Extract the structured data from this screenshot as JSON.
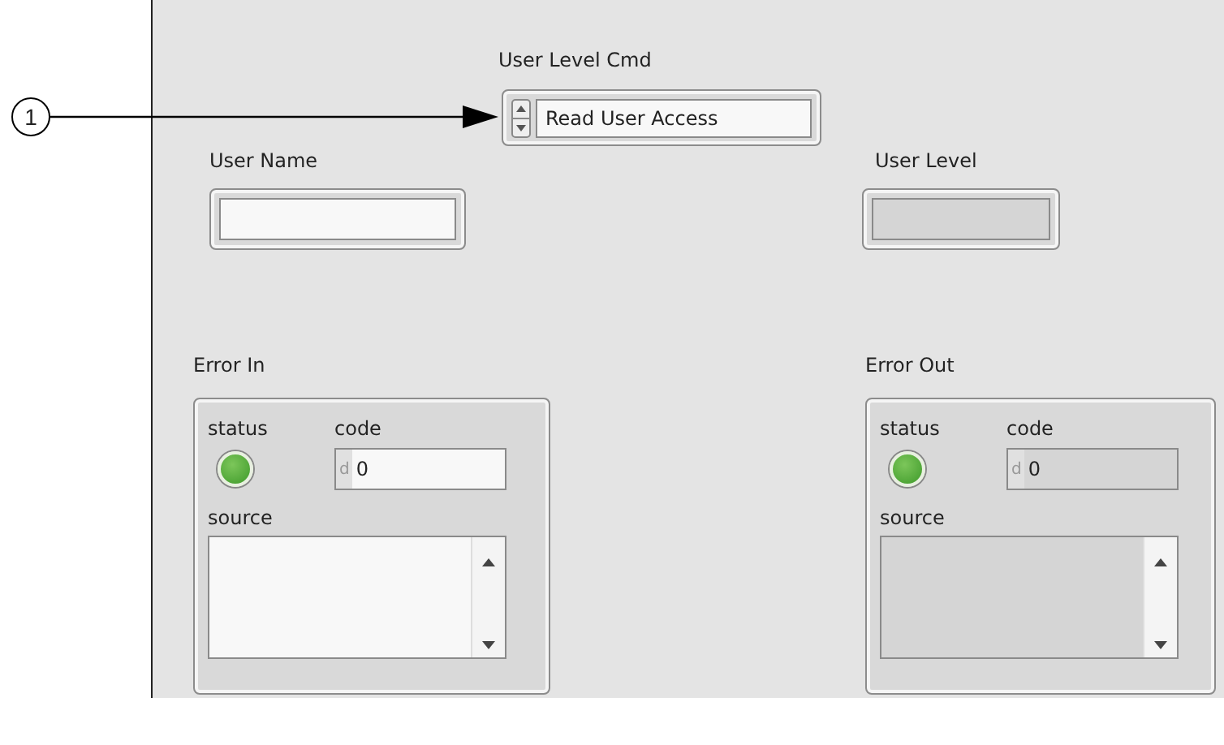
{
  "callout": {
    "number": "1"
  },
  "user_level_cmd": {
    "label": "User Level Cmd",
    "value": "Read User Access"
  },
  "user_name": {
    "label": "User Name",
    "indicator": false
  },
  "user_level": {
    "label": "User Level",
    "indicator": true
  },
  "clusters": [
    {
      "label": "Error In",
      "kind": "control",
      "status_label": "status",
      "status_on": true,
      "code_label": "code",
      "radix": "d",
      "code": "0",
      "source_label": "source"
    },
    {
      "label": "Error Out",
      "kind": "indicator",
      "status_label": "status",
      "status_on": true,
      "code_label": "code",
      "radix": "d",
      "code": "0",
      "source_label": "source"
    }
  ]
}
